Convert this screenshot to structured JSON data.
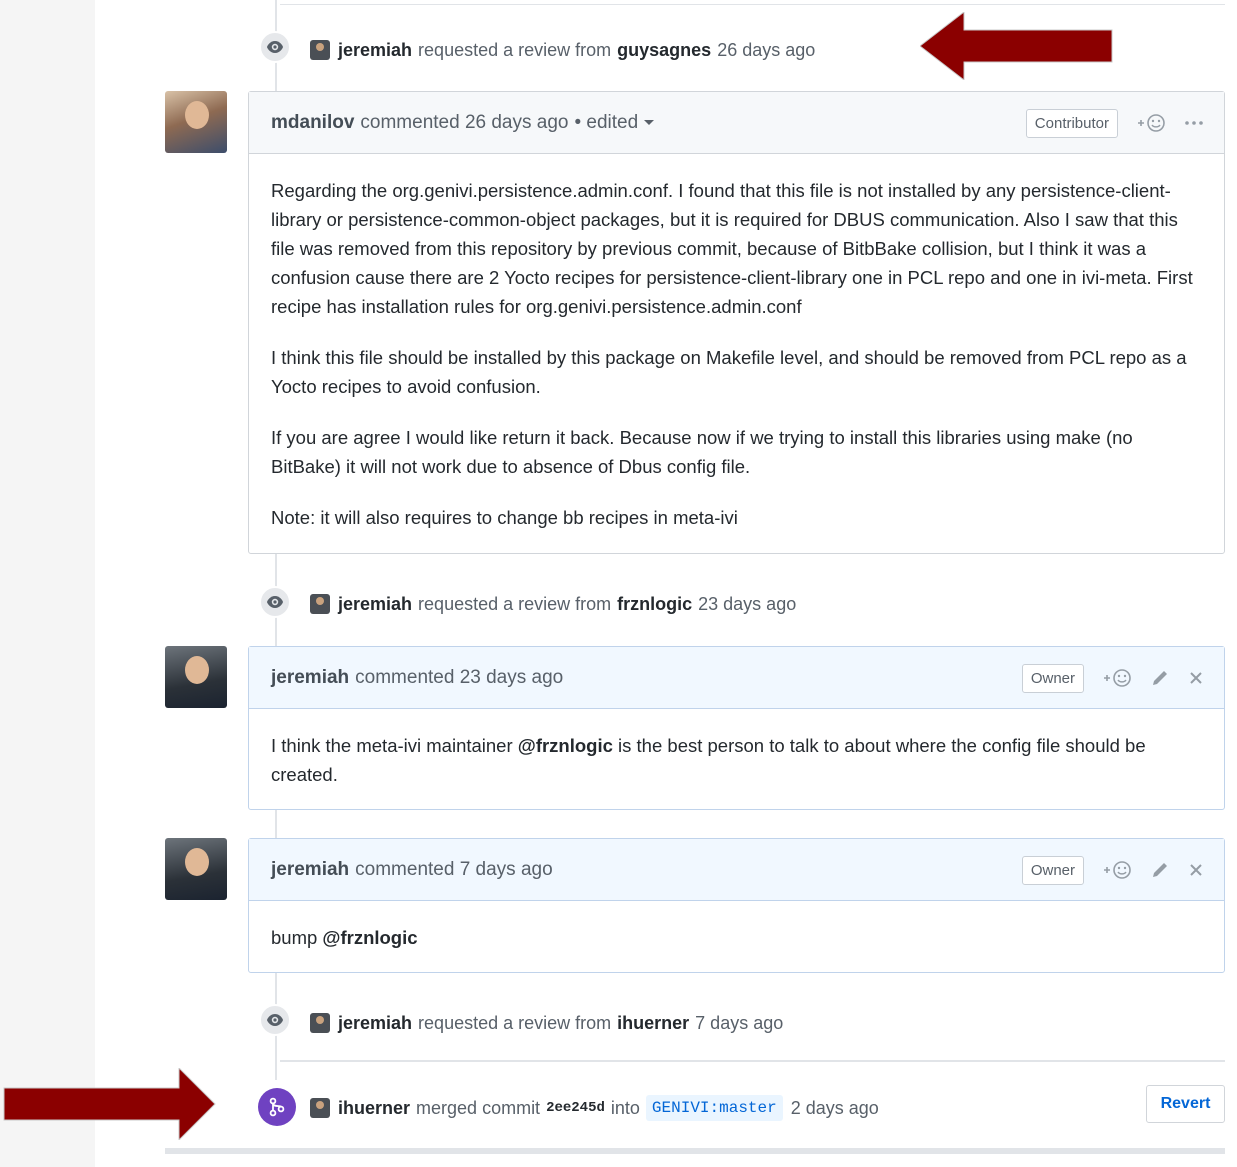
{
  "events": [
    {
      "actor": "jeremiah",
      "action": "requested a review from",
      "target": "guysagnes",
      "time": "26 days ago"
    },
    {
      "actor": "jeremiah",
      "action": "requested a review from",
      "target": "frznlogic",
      "time": "23 days ago"
    },
    {
      "actor": "jeremiah",
      "action": "requested a review from",
      "target": "ihuerner",
      "time": "7 days ago"
    }
  ],
  "comments": [
    {
      "author": "mdanilov",
      "meta": "commented 26 days ago",
      "edited": "• edited",
      "role": "Contributor",
      "paragraphs": [
        "Regarding the org.genivi.persistence.admin.conf. I found that this file is not installed by any persistence-client-library or persistence-common-object packages, but it is required for DBUS communication. Also I saw that this file was removed from this repository by previous commit, because of BitbBake collision, but I think it was a confusion cause there are 2 Yocto recipes for persistence-client-library one in PCL repo and one in ivi-meta. First recipe has installation rules for org.genivi.persistence.admin.conf",
        "I think this file should be installed by this package on Makefile level, and should be removed from PCL repo as a Yocto recipes to avoid confusion.",
        "If you are agree I would like return it back. Because now if we trying to install this libraries using make (no BitBake) it will not work due to absence of Dbus config file.",
        "Note: it will also requires to change bb recipes in meta-ivi"
      ]
    },
    {
      "author": "jeremiah",
      "meta": "commented 23 days ago",
      "role": "Owner",
      "body_before": "I think the meta-ivi maintainer ",
      "mention": "@frznlogic",
      "body_after": " is the best person to talk to about where the config file should be created."
    },
    {
      "author": "jeremiah",
      "meta": "commented 7 days ago",
      "role": "Owner",
      "body_before": "bump ",
      "mention": "@frznlogic",
      "body_after": ""
    }
  ],
  "merge": {
    "actor": "ihuerner",
    "action": "merged commit",
    "commit": "2ee245d",
    "into": "into",
    "branch": "GENIVI:master",
    "time": "2 days ago",
    "revert_label": "Revert"
  },
  "icons": {
    "eye": "eye-icon",
    "reaction": "add-reaction-icon",
    "more": "more-options-icon",
    "edit": "pencil-icon",
    "delete": "close-icon",
    "merge": "git-merge-icon"
  },
  "colors": {
    "arrow": "#8b0000",
    "merge_badge": "#6f42c1",
    "link": "#0366d6"
  }
}
